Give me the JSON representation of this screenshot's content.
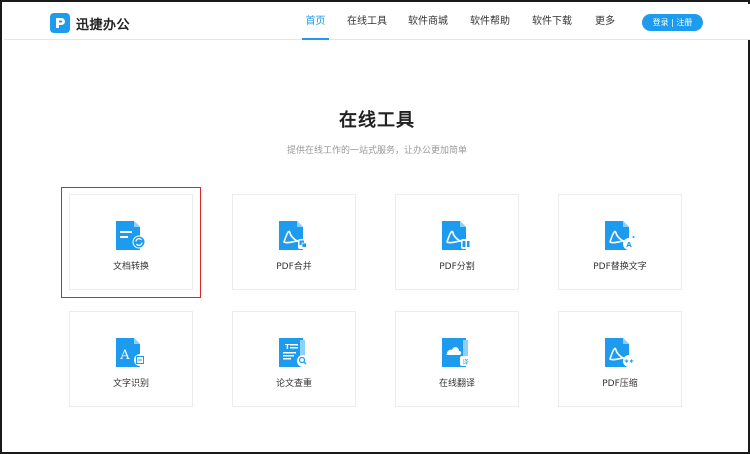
{
  "header": {
    "logo_text": "迅捷办公",
    "nav": [
      {
        "label": "首页",
        "active": true
      },
      {
        "label": "在线工具",
        "active": false
      },
      {
        "label": "软件商城",
        "active": false
      },
      {
        "label": "软件帮助",
        "active": false
      },
      {
        "label": "软件下载",
        "active": false
      },
      {
        "label": "更多",
        "active": false
      }
    ],
    "login_label": "登录 | 注册"
  },
  "main": {
    "title": "在线工具",
    "subtitle": "提供在线工作的一站式服务，让办公更加简单"
  },
  "tools": [
    {
      "label": "文档转换",
      "icon": "doc-convert-icon",
      "selected": true
    },
    {
      "label": "PDF合并",
      "icon": "pdf-merge-icon",
      "selected": false
    },
    {
      "label": "PDF分割",
      "icon": "pdf-split-icon",
      "selected": false
    },
    {
      "label": "PDF替换文字",
      "icon": "pdf-replace-text-icon",
      "selected": false
    },
    {
      "label": "文字识别",
      "icon": "text-recognition-icon",
      "selected": false
    },
    {
      "label": "论文查重",
      "icon": "paper-check-icon",
      "selected": false
    },
    {
      "label": "在线翻译",
      "icon": "online-translate-icon",
      "selected": false
    },
    {
      "label": "PDF压缩",
      "icon": "pdf-compress-icon",
      "selected": false
    }
  ],
  "colors": {
    "accent": "#1c9bef",
    "highlight": "#d9262b"
  }
}
